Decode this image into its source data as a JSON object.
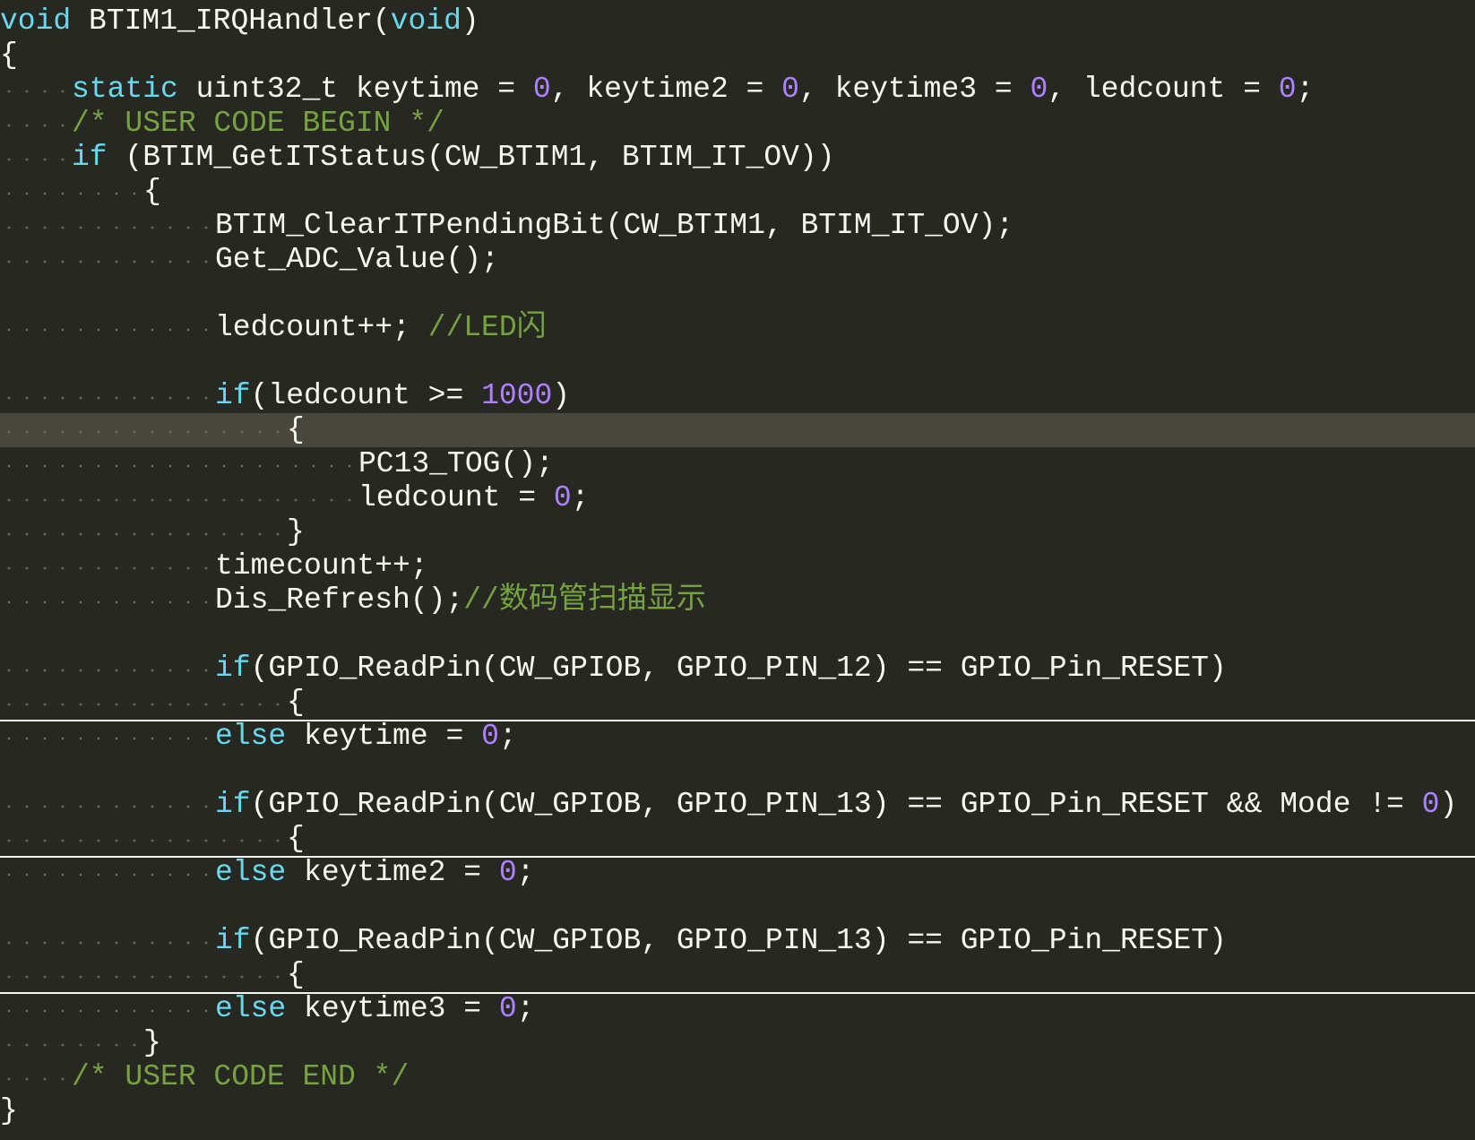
{
  "editor": {
    "theme_colors": {
      "background": "#272822",
      "text": "#F8F8F2",
      "keyword": "#66D9EF",
      "comment": "#75A340",
      "number": "#AE81FF",
      "current_line": "#49483E"
    },
    "lines": [
      {
        "indent": 0,
        "tokens": [
          {
            "t": "kw",
            "v": "void"
          },
          {
            "t": "op",
            "v": " BTIM1_IRQHandler("
          },
          {
            "t": "kw",
            "v": "void"
          },
          {
            "t": "op",
            "v": ")"
          }
        ]
      },
      {
        "indent": 0,
        "tokens": [
          {
            "t": "op",
            "v": "{"
          }
        ]
      },
      {
        "indent": 4,
        "tokens": [
          {
            "t": "kw",
            "v": "static"
          },
          {
            "t": "op",
            "v": " uint32_t keytime = "
          },
          {
            "t": "num",
            "v": "0"
          },
          {
            "t": "op",
            "v": ", keytime2 = "
          },
          {
            "t": "num",
            "v": "0"
          },
          {
            "t": "op",
            "v": ", keytime3 = "
          },
          {
            "t": "num",
            "v": "0"
          },
          {
            "t": "op",
            "v": ", ledcount = "
          },
          {
            "t": "num",
            "v": "0"
          },
          {
            "t": "op",
            "v": ";"
          }
        ]
      },
      {
        "indent": 4,
        "tokens": [
          {
            "t": "cm",
            "v": "/* USER CODE BEGIN */"
          }
        ]
      },
      {
        "indent": 4,
        "tokens": [
          {
            "t": "kw",
            "v": "if"
          },
          {
            "t": "op",
            "v": " (BTIM_GetITStatus(CW_BTIM1, BTIM_IT_OV))"
          }
        ]
      },
      {
        "indent": 8,
        "tokens": [
          {
            "t": "op",
            "v": "{"
          }
        ]
      },
      {
        "indent": 12,
        "tokens": [
          {
            "t": "op",
            "v": "BTIM_ClearITPendingBit(CW_BTIM1, BTIM_IT_OV);"
          }
        ]
      },
      {
        "indent": 12,
        "tokens": [
          {
            "t": "op",
            "v": "Get_ADC_Value();"
          }
        ]
      },
      {
        "indent": 0,
        "tokens": []
      },
      {
        "indent": 12,
        "tokens": [
          {
            "t": "op",
            "v": "ledcount++; "
          },
          {
            "t": "cm",
            "v": "//LED闪"
          }
        ]
      },
      {
        "indent": 0,
        "tokens": []
      },
      {
        "indent": 12,
        "tokens": [
          {
            "t": "kw",
            "v": "if"
          },
          {
            "t": "op",
            "v": "(ledcount >= "
          },
          {
            "t": "num",
            "v": "1000"
          },
          {
            "t": "op",
            "v": ")"
          }
        ]
      },
      {
        "indent": 16,
        "current": true,
        "tokens": [
          {
            "t": "op",
            "v": "{"
          }
        ]
      },
      {
        "indent": 20,
        "tokens": [
          {
            "t": "op",
            "v": "PC13_TOG();"
          }
        ]
      },
      {
        "indent": 20,
        "tokens": [
          {
            "t": "op",
            "v": "ledcount = "
          },
          {
            "t": "num",
            "v": "0"
          },
          {
            "t": "op",
            "v": ";"
          }
        ]
      },
      {
        "indent": 16,
        "tokens": [
          {
            "t": "op",
            "v": "}"
          }
        ]
      },
      {
        "indent": 12,
        "tokens": [
          {
            "t": "op",
            "v": "timecount++;"
          }
        ]
      },
      {
        "indent": 12,
        "tokens": [
          {
            "t": "op",
            "v": "Dis_Refresh();"
          },
          {
            "t": "cm",
            "v": "//数码管扫描显示"
          }
        ]
      },
      {
        "indent": 0,
        "tokens": []
      },
      {
        "indent": 12,
        "tokens": [
          {
            "t": "kw",
            "v": "if"
          },
          {
            "t": "op",
            "v": "(GPIO_ReadPin(CW_GPIOB, GPIO_PIN_12) == GPIO_Pin_RESET)"
          }
        ]
      },
      {
        "indent": 16,
        "fold": true,
        "tokens": [
          {
            "t": "op",
            "v": "{"
          }
        ]
      },
      {
        "indent": 12,
        "tokens": [
          {
            "t": "kw",
            "v": "else"
          },
          {
            "t": "op",
            "v": " keytime = "
          },
          {
            "t": "num",
            "v": "0"
          },
          {
            "t": "op",
            "v": ";"
          }
        ]
      },
      {
        "indent": 0,
        "tokens": []
      },
      {
        "indent": 12,
        "tokens": [
          {
            "t": "kw",
            "v": "if"
          },
          {
            "t": "op",
            "v": "(GPIO_ReadPin(CW_GPIOB, GPIO_PIN_13) == GPIO_Pin_RESET && Mode != "
          },
          {
            "t": "num",
            "v": "0"
          },
          {
            "t": "op",
            "v": ")"
          }
        ]
      },
      {
        "indent": 16,
        "fold": true,
        "tokens": [
          {
            "t": "op",
            "v": "{"
          }
        ]
      },
      {
        "indent": 12,
        "tokens": [
          {
            "t": "kw",
            "v": "else"
          },
          {
            "t": "op",
            "v": " keytime2 = "
          },
          {
            "t": "num",
            "v": "0"
          },
          {
            "t": "op",
            "v": ";"
          }
        ]
      },
      {
        "indent": 0,
        "tokens": []
      },
      {
        "indent": 12,
        "tokens": [
          {
            "t": "kw",
            "v": "if"
          },
          {
            "t": "op",
            "v": "(GPIO_ReadPin(CW_GPIOB, GPIO_PIN_13) == GPIO_Pin_RESET)"
          }
        ]
      },
      {
        "indent": 16,
        "fold": true,
        "tokens": [
          {
            "t": "op",
            "v": "{"
          }
        ]
      },
      {
        "indent": 12,
        "tokens": [
          {
            "t": "kw",
            "v": "else"
          },
          {
            "t": "op",
            "v": " keytime3 = "
          },
          {
            "t": "num",
            "v": "0"
          },
          {
            "t": "op",
            "v": ";"
          }
        ]
      },
      {
        "indent": 8,
        "tokens": [
          {
            "t": "op",
            "v": "}"
          }
        ]
      },
      {
        "indent": 4,
        "tokens": [
          {
            "t": "cm",
            "v": "/* USER CODE END */"
          }
        ]
      },
      {
        "indent": 0,
        "tokens": [
          {
            "t": "op",
            "v": "}"
          }
        ]
      }
    ]
  }
}
